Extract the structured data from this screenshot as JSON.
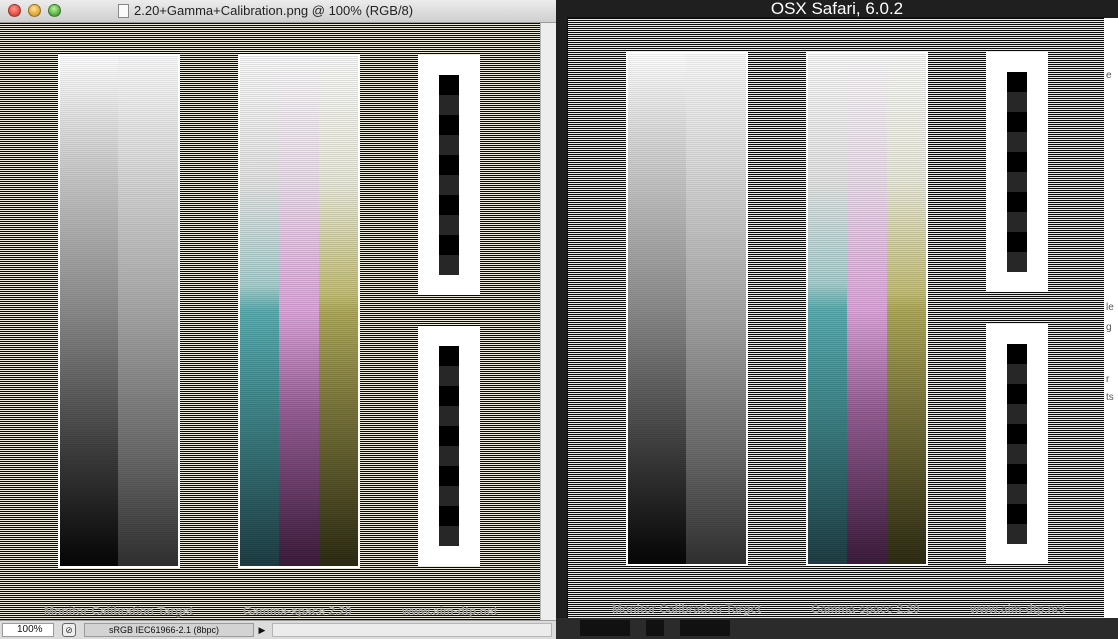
{
  "left_window": {
    "title": "2.20+Gamma+Calibration.png @ 100% (RGB/8)",
    "status_bar": {
      "zoom": "100%",
      "color_profile": "sRGB IEC61966-2.1 (8bpc)",
      "arrow": "▶",
      "icon": "⊘"
    },
    "target_footer": {
      "label_left": "Monitor Calibration Target",
      "label_center": "Gamma-space 2.20",
      "label_right": "www.aim-dtp.net"
    }
  },
  "right_window": {
    "title": "OSX Safari, 6.0.2",
    "target_footer": {
      "label_left": "Monitor Calibration Target",
      "label_center": "Gamma-space 2.20",
      "label_right": "www.aim-dtp.net"
    },
    "edge_glyphs": [
      "e",
      "le",
      "g",
      "r",
      "ts"
    ]
  },
  "colors": {
    "line_dark": "#0b0b0b",
    "line_light": "#eceadc",
    "cyan": "#57b2b6",
    "magenta": "#e3a6e1",
    "yellow": "#b2ad57",
    "footer_text": "#9c9c9c"
  }
}
